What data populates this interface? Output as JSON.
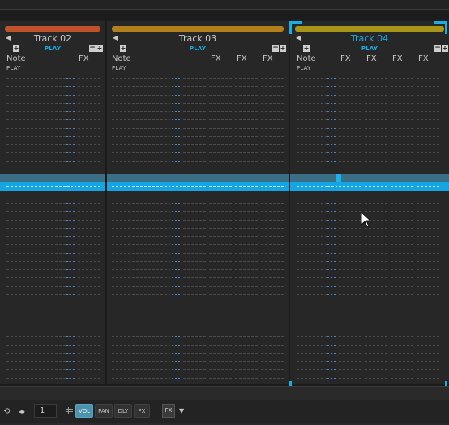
{
  "tracks": [
    {
      "name": "Track 02",
      "color": "#c0522a",
      "play": "PLAY",
      "note_header": "Note",
      "note_sub": "PLAY",
      "fx_headers": [
        "FX"
      ],
      "selected": false
    },
    {
      "name": "Track 03",
      "color": "#b4801c",
      "play": "PLAY",
      "note_header": "Note",
      "note_sub": "PLAY",
      "fx_headers": [
        "FX",
        "FX",
        "FX"
      ],
      "selected": false
    },
    {
      "name": "Track 04",
      "color": "#a7961a",
      "play": "PLAY",
      "note_header": "Note",
      "note_sub": "PLAY",
      "fx_headers": [
        "FX",
        "FX",
        "FX",
        "FX"
      ],
      "selected": true
    }
  ],
  "colors": {
    "accent": "#18aee6",
    "cursor_row": "#14a5e2",
    "band_row": "#3b6f86"
  },
  "icons": {
    "add": "plus-icon",
    "remove": "minus-icon",
    "collapse": "arrow-left-icon",
    "grid": "grid-icon"
  },
  "bottom": {
    "step_value": "1",
    "chips": [
      "VOL",
      "PAN",
      "DLY",
      "FX"
    ],
    "active_chip": "VOL",
    "fx_select_label": "FX"
  }
}
